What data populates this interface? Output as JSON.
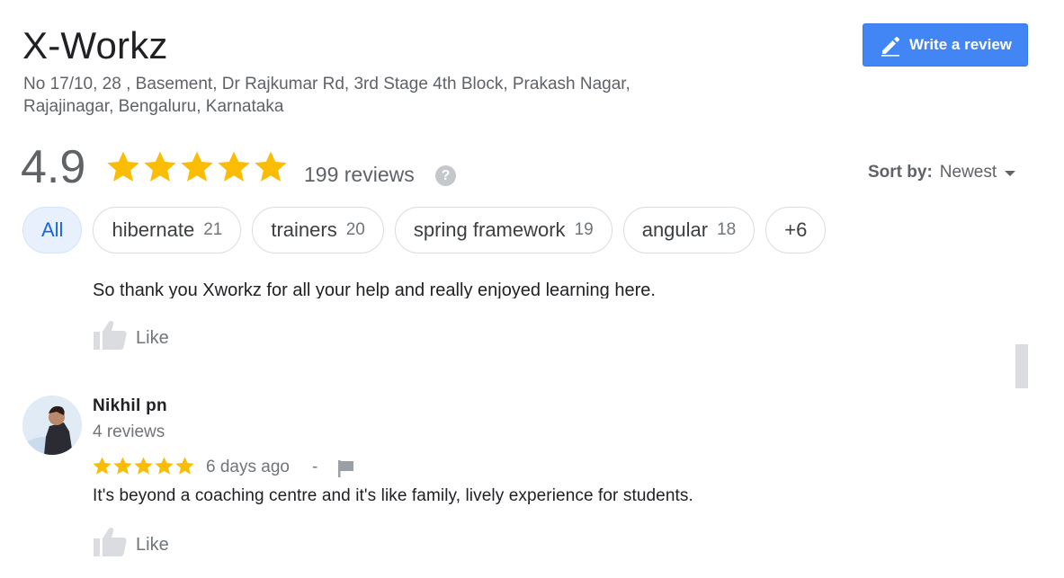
{
  "place": {
    "name": "X-Workz",
    "address_line1": "No 17/10, 28 , Basement, Dr Rajkumar Rd, 3rd Stage 4th Block, Prakash Nagar,",
    "address_line2": "Rajajinagar, Bengaluru, Karnataka"
  },
  "write_review": {
    "label": "Write a review",
    "icon": "pencil-icon"
  },
  "summary": {
    "rating": "4.9",
    "stars": 5,
    "reviews": "199 reviews",
    "help_icon": "?"
  },
  "sort": {
    "label": "Sort by:",
    "value": "Newest"
  },
  "filters": [
    {
      "label": "All",
      "count": "",
      "active": true
    },
    {
      "label": "hibernate",
      "count": "21"
    },
    {
      "label": "trainers",
      "count": "20"
    },
    {
      "label": "spring framework",
      "count": "19"
    },
    {
      "label": "angular",
      "count": "18"
    },
    {
      "label": "+6",
      "count": ""
    }
  ],
  "previous_review": {
    "text": "So thank you Xworkz for all your help and really enjoyed learning here.",
    "like_label": "Like"
  },
  "review": {
    "author": "Nikhil pn",
    "author_reviews": "4 reviews",
    "stars": 5,
    "date": "6 days ago",
    "separator": "-",
    "text": "It's beyond a coaching centre and it's like family, lively experience for students.",
    "like_label": "Like"
  },
  "colors": {
    "star": "#fbbc04",
    "accent": "#4285f4",
    "chip_active_bg": "#e8f0fe",
    "chip_active_text": "#1967d2"
  }
}
